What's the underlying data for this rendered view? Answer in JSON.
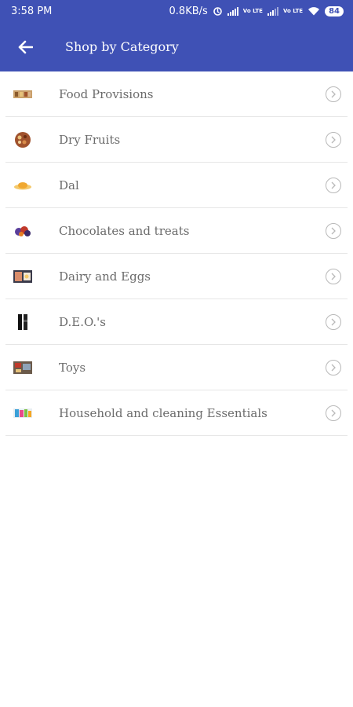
{
  "status_bar": {
    "time": "3:58 PM",
    "speed": "0.8KB/s",
    "volte_1": "Vo LTE",
    "volte_2": "Vo LTE",
    "battery": "84"
  },
  "header": {
    "title": "Shop by Category"
  },
  "categories": [
    {
      "label": "Food Provisions",
      "icon": "food-provisions-thumbnail"
    },
    {
      "label": "Dry Fruits",
      "icon": "dry-fruits-thumbnail"
    },
    {
      "label": "Dal",
      "icon": "dal-thumbnail"
    },
    {
      "label": "Chocolates and treats",
      "icon": "chocolates-thumbnail"
    },
    {
      "label": "Dairy and Eggs",
      "icon": "dairy-eggs-thumbnail"
    },
    {
      "label": "D.E.O.'s",
      "icon": "deo-thumbnail"
    },
    {
      "label": "Toys",
      "icon": "toys-thumbnail"
    },
    {
      "label": "Household and cleaning Essentials",
      "icon": "household-thumbnail"
    }
  ],
  "colors": {
    "primary": "#3f51b5",
    "label_text": "#6b6b6b",
    "divider": "#e6e6e6"
  }
}
